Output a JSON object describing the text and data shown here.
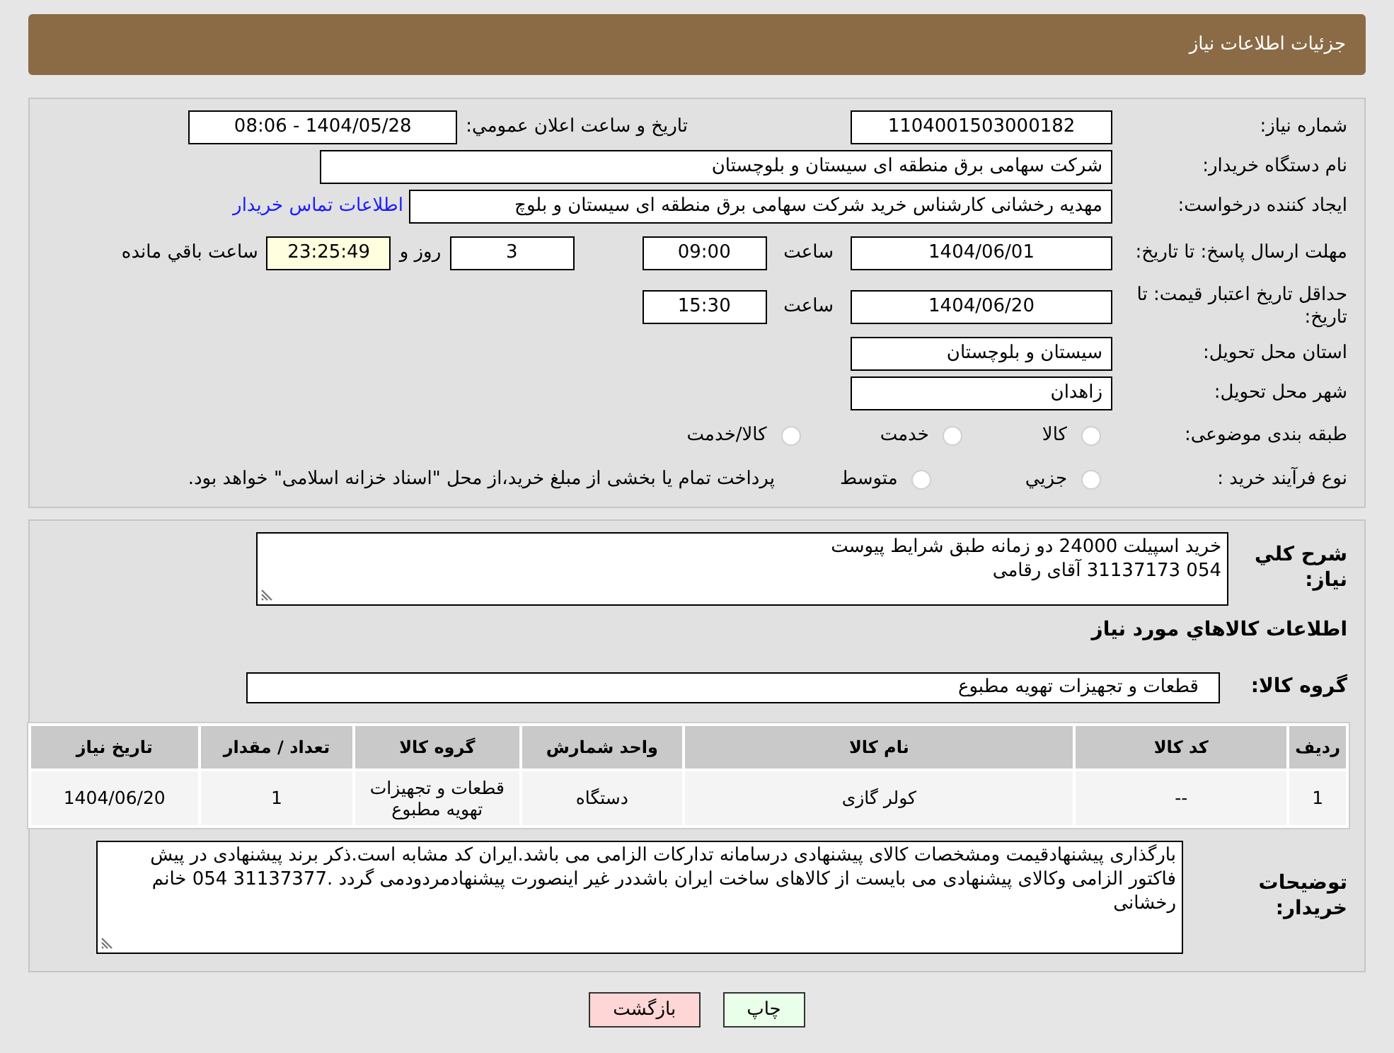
{
  "header": {
    "title": "جزئیات اطلاعات نیاز"
  },
  "need_info": {
    "need_number": {
      "label": "شماره نیاز:",
      "value": "1104001503000182"
    },
    "announce": {
      "label": "تاريخ و ساعت اعلان عمومي:",
      "value": "1404/05/28 - 08:06"
    },
    "buyer": {
      "label": "نام دستگاه خريدار:",
      "value": "شرکت سهامی برق منطقه ای سیستان و بلوچستان"
    },
    "creator": {
      "label": "ایجاد کننده درخواست:",
      "value": "مهدیه رخشانی کارشناس خرید شرکت سهامی برق منطقه ای سیستان و بلوچ",
      "link": "اطلاعات تماس خريدار"
    },
    "deadline": {
      "label": "مهلت ارسال پاسخ: تا تاریخ:",
      "date": "1404/06/01",
      "time_label": "ساعت",
      "time": "09:00",
      "days": "3",
      "days_label": "روز و",
      "remaining": "23:25:49",
      "remaining_label": "ساعت باقي مانده"
    },
    "validity": {
      "label": "حداقل تاریخ اعتبار قیمت: تا تاریخ:",
      "date": "1404/06/20",
      "time_label": "ساعت",
      "time": "15:30"
    },
    "province": {
      "label": "استان محل تحویل:",
      "value": "سیستان و بلوچستان"
    },
    "city": {
      "label": "شهر محل تحویل:",
      "value": "زاهدان"
    },
    "category": {
      "label": "طبقه بندی موضوعی:",
      "options": [
        {
          "label": "کالا",
          "selected": false
        },
        {
          "label": "خدمت",
          "selected": false
        },
        {
          "label": "کالا/خدمت",
          "selected": false
        }
      ]
    },
    "process": {
      "label": "نوع فرآیند خرید :",
      "options": [
        {
          "label": "جزيي",
          "selected": false
        },
        {
          "label": "متوسط",
          "selected": false
        }
      ],
      "note": "پرداخت تمام یا بخشی از مبلغ خرید،از محل \"اسناد خزانه اسلامی\" خواهد بود."
    }
  },
  "needs": {
    "summary_label": "شرح كلي نياز:",
    "summary_lines": [
      "خرید اسپیلت 24000 دو زمانه طبق شرایط پیوست",
      "054 31137173 آقای رقامی"
    ],
    "goods_heading": "اطلاعات كالاهاي مورد نياز",
    "group_label": "گروه کالا:",
    "group": "قطعات و تجهیزات تهویه مطبوع",
    "table": {
      "columns": [
        "ردیف",
        "کد کالا",
        "نام کالا",
        "واحد شمارش",
        "گروه کالا",
        "تعداد / مقدار",
        "تاریخ نیاز"
      ],
      "rows": [
        [
          "1",
          "--",
          "کولر گازی",
          "دستگاه",
          "قطعات و تجهیزات تهویه مطبوع",
          "1",
          "1404/06/20"
        ]
      ]
    },
    "buyer_notes_label": "توضیحات خریدار:",
    "buyer_notes": "بارگذاری پیشنهادقیمت ومشخصات کالای پیشنهادی درسامانه تدارکات الزامی می باشد.ایران کد مشابه است.ذکر برند پیشنهادی در پیش فاکتور الزامی وکالای پیشنهادی می بایست از کالاهای ساخت ایران باشددر غیر اینصورت پیشنهادمردودمی گردد .31137377 054 خانم رخشانی"
  },
  "buttons": [
    {
      "label": "چاپ",
      "kind": "print"
    },
    {
      "label": "بازگشت",
      "kind": "back"
    }
  ]
}
